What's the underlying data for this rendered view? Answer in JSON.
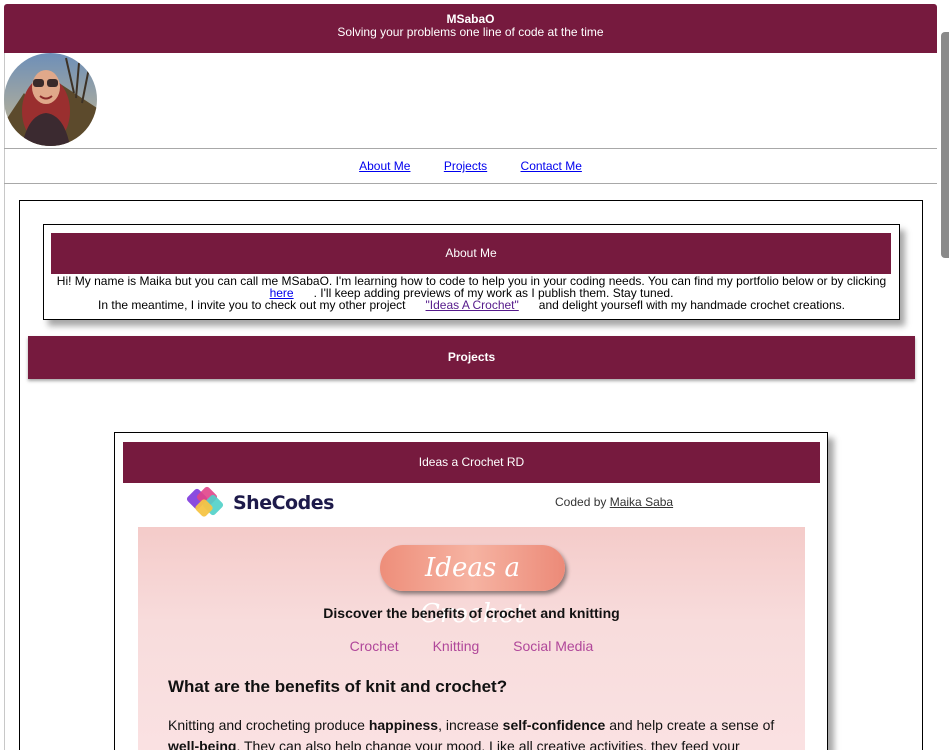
{
  "header": {
    "title": "MSabaO",
    "subtitle": "Solving your problems one line of code at the time"
  },
  "nav": {
    "items": [
      "About Me",
      "Projects",
      "Contact Me"
    ]
  },
  "about": {
    "title": "About Me",
    "line1": "Hi! My name is Maika but you can call me MSabaO. I'm learning how to code to help you in your coding needs. You can find my portfolio below or by clicking",
    "here_link": "here",
    "line2_rest": ". I'll keep adding previews of my work as I publish them. Stay tuned.",
    "line3_pre": "In the meantime, I invite you to check out my other project",
    "crochet_link": "\"Ideas A Crochet\"",
    "line3_post": "and delight yoursefl with my handmade crochet creations."
  },
  "projects": {
    "title": "Projects",
    "card_title": "Ideas a Crochet RD",
    "preview": {
      "brand": "SheCodes",
      "coded_by_label": "Coded by",
      "coded_by_name": "Maika Saba",
      "logo_text": "Ideas a Crochet",
      "tagline": "Discover the benefits of crochet and knitting",
      "nav": [
        "Crochet",
        "Knitting",
        "Social Media"
      ],
      "question": "What are the benefits of knit and crochet?",
      "p1_a": "Knitting and crocheting produce ",
      "p1_b": "happiness",
      "p1_c": ", increase ",
      "p1_d": "self-confidence",
      "p1_e": " and help create a sense of ",
      "p1_f": "well-being",
      "p1_g": ". They can also help change your mood. Like all creative activities, they feed your"
    }
  },
  "colors": {
    "brand": "#761a3e",
    "link": "#0000ee",
    "preview_nav": "#b0479a"
  }
}
